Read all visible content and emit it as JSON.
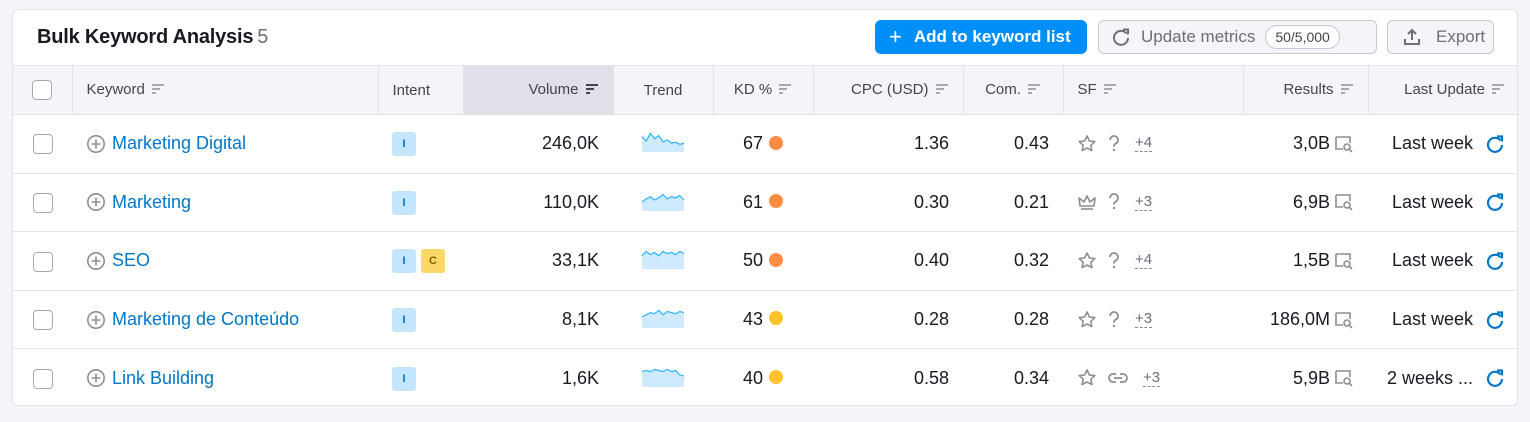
{
  "header": {
    "title": "Bulk Keyword Analysis",
    "count": "5",
    "add_label": "Add to keyword list",
    "update_label": "Update metrics",
    "update_quota": "50/5,000",
    "export_label": "Export"
  },
  "columns": {
    "keyword": "Keyword",
    "intent": "Intent",
    "volume": "Volume",
    "trend": "Trend",
    "kd": "KD %",
    "cpc": "CPC (USD)",
    "com": "Com.",
    "sf": "SF",
    "results": "Results",
    "last_update": "Last Update"
  },
  "colors": {
    "accent": "#008ff8",
    "link": "#0077c7",
    "kd_orange": "#ff8c43",
    "kd_yellow": "#ffc32b",
    "intent_informational": "#c4e5fe",
    "intent_commercial": "#fcd869"
  },
  "rows": [
    {
      "keyword": "Marketing Digital",
      "intents": [
        "I"
      ],
      "volume": "246,0K",
      "trend": [
        0.7,
        0.5,
        0.85,
        0.6,
        0.75,
        0.45,
        0.55,
        0.4,
        0.45,
        0.35,
        0.4
      ],
      "kd": "67",
      "kd_color": "#ff8c43",
      "cpc": "1.36",
      "com": "0.43",
      "sf_icons": [
        "star-icon",
        "question-icon"
      ],
      "sf_more": "+4",
      "results": "3,0B",
      "last_update": "Last week"
    },
    {
      "keyword": "Marketing",
      "intents": [
        "I"
      ],
      "volume": "110,0K",
      "trend": [
        0.4,
        0.55,
        0.65,
        0.5,
        0.6,
        0.75,
        0.55,
        0.65,
        0.6,
        0.7,
        0.5
      ],
      "kd": "61",
      "kd_color": "#ff8c43",
      "cpc": "0.30",
      "com": "0.21",
      "sf_icons": [
        "crown-icon",
        "question-icon"
      ],
      "sf_more": "+3",
      "results": "6,9B",
      "last_update": "Last week"
    },
    {
      "keyword": "SEO",
      "intents": [
        "I",
        "C"
      ],
      "volume": "33,1K",
      "trend": [
        0.6,
        0.8,
        0.65,
        0.75,
        0.6,
        0.8,
        0.7,
        0.75,
        0.65,
        0.8,
        0.7
      ],
      "kd": "50",
      "kd_color": "#ff8c43",
      "cpc": "0.40",
      "com": "0.32",
      "sf_icons": [
        "star-icon",
        "question-icon"
      ],
      "sf_more": "+4",
      "results": "1,5B",
      "last_update": "Last week"
    },
    {
      "keyword": "Marketing de Conteúdo",
      "intents": [
        "I"
      ],
      "volume": "8,1K",
      "trend": [
        0.5,
        0.6,
        0.7,
        0.65,
        0.8,
        0.6,
        0.75,
        0.7,
        0.65,
        0.75,
        0.7
      ],
      "kd": "43",
      "kd_color": "#ffc32b",
      "cpc": "0.28",
      "com": "0.28",
      "sf_icons": [
        "star-icon",
        "question-icon"
      ],
      "sf_more": "+3",
      "results": "186,0M",
      "last_update": "Last week"
    },
    {
      "keyword": "Link Building",
      "intents": [
        "I"
      ],
      "volume": "1,6K",
      "trend": [
        0.7,
        0.75,
        0.7,
        0.8,
        0.75,
        0.7,
        0.8,
        0.7,
        0.75,
        0.55,
        0.5
      ],
      "kd": "40",
      "kd_color": "#ffc32b",
      "cpc": "0.58",
      "com": "0.34",
      "sf_icons": [
        "star-icon",
        "link-icon"
      ],
      "sf_more": "+3",
      "results": "5,9B",
      "last_update": "2 weeks ..."
    }
  ]
}
